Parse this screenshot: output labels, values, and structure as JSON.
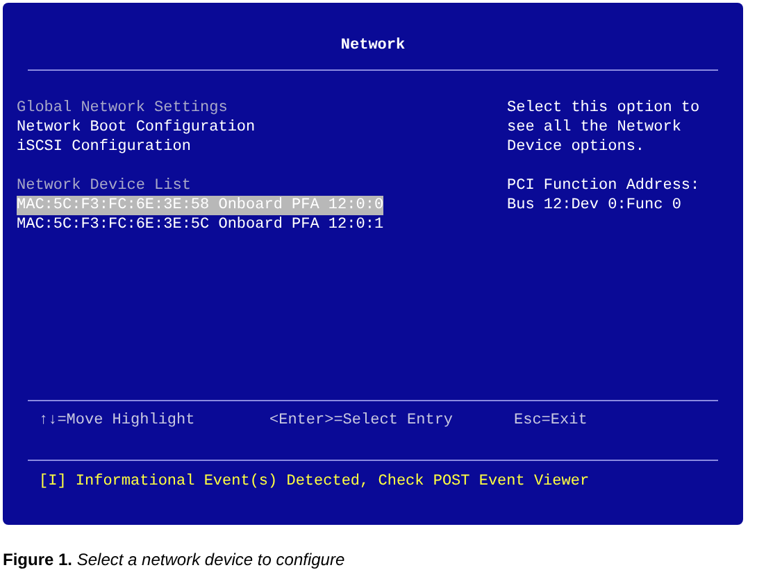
{
  "screen": {
    "title": "Network",
    "menu": [
      {
        "kind": "disabled",
        "label": "Global Network Settings",
        "selected": false
      },
      {
        "kind": "item",
        "label": "Network Boot Configuration",
        "selected": false
      },
      {
        "kind": "item",
        "label": "iSCSI Configuration",
        "selected": false
      },
      {
        "kind": "gap"
      },
      {
        "kind": "heading",
        "label": "Network Device List",
        "selected": false
      },
      {
        "kind": "item",
        "label": "MAC:5C:F3:FC:6E:3E:58 Onboard PFA 12:0:0",
        "selected": true
      },
      {
        "kind": "item",
        "label": "MAC:5C:F3:FC:6E:3E:5C Onboard PFA 12:0:1",
        "selected": false
      }
    ],
    "help": [
      [
        "Select this option to",
        "see all the Network",
        "Device options."
      ],
      [
        "PCI Function Address:",
        "Bus 12:Dev 0:Func 0"
      ]
    ],
    "keys": [
      "↑↓=Move Highlight",
      "<Enter>=Select Entry",
      "Esc=Exit"
    ],
    "status": "[I] Informational Event(s) Detected, Check POST Event Viewer"
  },
  "caption": "**Figure 1.** *Select a network device to configure*"
}
